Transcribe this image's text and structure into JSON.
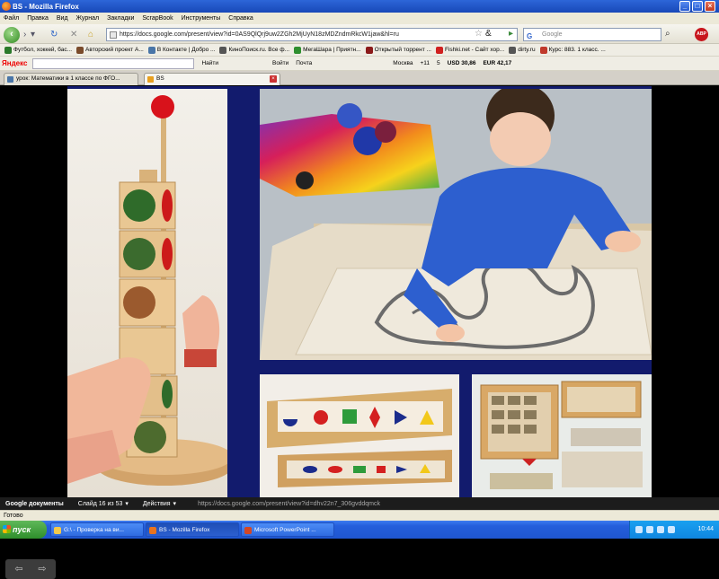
{
  "window": {
    "title": "BS - Mozilla Firefox"
  },
  "menu": [
    "Файл",
    "Правка",
    "Вид",
    "Журнал",
    "Закладки",
    "ScrapBook",
    "Инструменты",
    "Справка"
  ],
  "nav": {
    "url": "https://docs.google.com/present/view?id=0AS9QlQrj9uw2ZGh2MjUyN18zMDZndmRkcW1jaw&hl=ru",
    "search_placeholder": "Google",
    "search_engine_letter": "G"
  },
  "bookmarks": [
    {
      "label": "Футбол, хоккей, бас...",
      "color": "#2b7a2b"
    },
    {
      "label": "Авторский проект А...",
      "color": "#7a4b2b"
    },
    {
      "label": "В Контакте | Добро ...",
      "color": "#4a76a8"
    },
    {
      "label": "КиноПоиск.ru. Все ф...",
      "color": "#555555"
    },
    {
      "label": "МегаШара | Приятн...",
      "color": "#2f8f2f"
    },
    {
      "label": "Открытый торрент ...",
      "color": "#8b1a1a"
    },
    {
      "label": "Fishki.net - Сайт хор...",
      "color": "#d02020"
    },
    {
      "label": "dirty.ru",
      "color": "#555555"
    },
    {
      "label": "Курс: 883. 1 класс. ...",
      "color": "#c0392b"
    }
  ],
  "yandex": {
    "logo": "Яндекс",
    "find": "Найти",
    "login": "Войти",
    "mail": "Почта",
    "city": "Москва",
    "temp": "+11",
    "count": "5",
    "usd": "USD 30,86",
    "eur": "EUR 42,17"
  },
  "tabs": [
    {
      "label": "урок: Математики в 1 классе по ФГО...",
      "active": false
    },
    {
      "label": "BS",
      "active": true
    }
  ],
  "docsbar": {
    "logo": "Google документы",
    "slide_counter": "Слайд 16 из 53",
    "actions": "Действия",
    "link": "https://docs.google.com/present/view?id=dhv22n7_306gvddqmck"
  },
  "status": "Готово",
  "taskbar": {
    "start": "пуск",
    "items": [
      {
        "label": "G:\\ - Проверка на ви...",
        "active": false
      },
      {
        "label": "BS - Mozilla Firefox",
        "active": true
      },
      {
        "label": "Microsoft PowerPoint ...",
        "active": false
      }
    ],
    "clock": "10:44"
  }
}
